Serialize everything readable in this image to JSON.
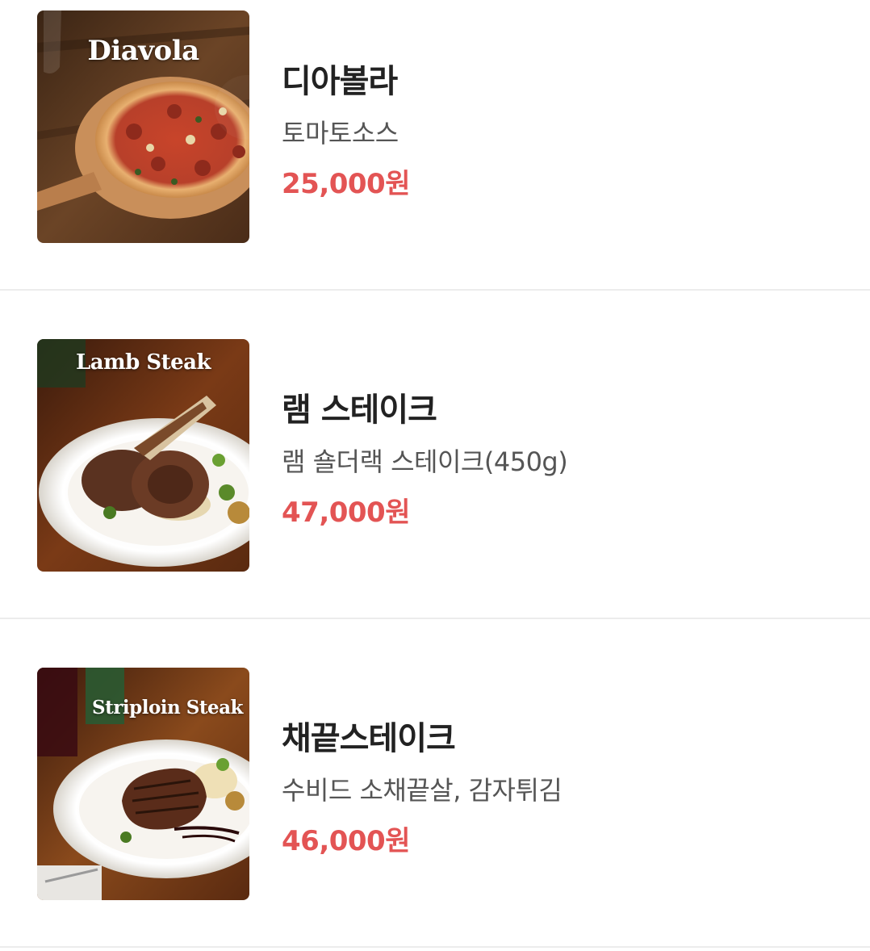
{
  "menu": {
    "items": [
      {
        "image_caption": "Diavola",
        "name": "디아볼라",
        "description": "토마토소스",
        "price": "25,000원"
      },
      {
        "image_caption": "Lamb Steak",
        "name": "램 스테이크",
        "description": "램 숄더랙 스테이크(450g)",
        "price": "47,000원"
      },
      {
        "image_caption": "Striploin Steak",
        "name": "채끝스테이크",
        "description": "수비드 소채끝살, 감자튀김",
        "price": "46,000원"
      }
    ]
  },
  "colors": {
    "price": "#e35454",
    "name": "#222222",
    "description": "#555555",
    "divider": "#ececec"
  }
}
